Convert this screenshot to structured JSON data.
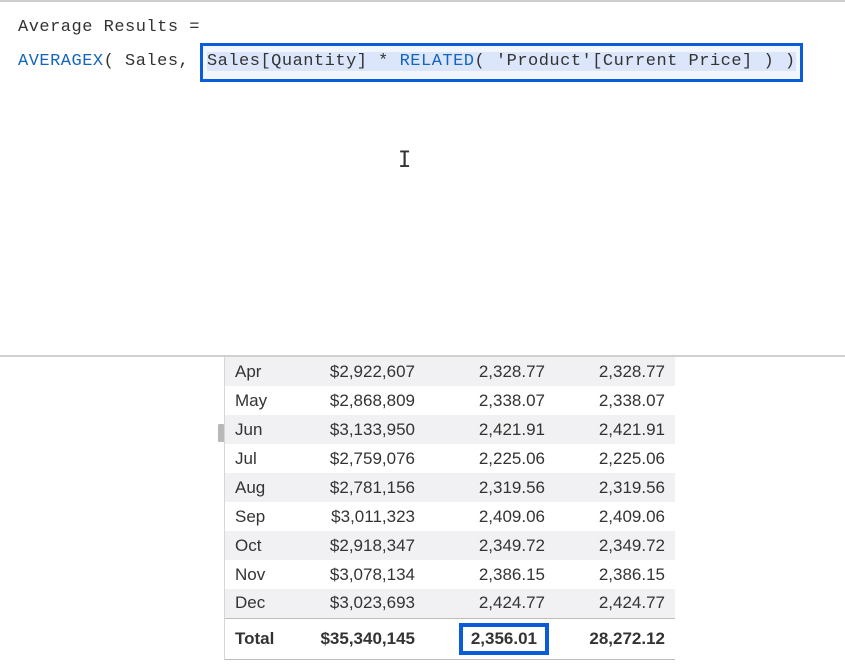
{
  "formula": {
    "line1_left": "Average Results",
    "line1_eq": " =",
    "fn_averagex": "AVERAGEX",
    "after_fn": "( Sales, ",
    "highlight_pre": "Sales[Quantity] * ",
    "fn_related": "RELATED",
    "highlight_post": "( 'Product'[Current Price] ) )"
  },
  "cursor_glyph": "I",
  "table": {
    "rows": [
      {
        "month": "Apr",
        "amount": "$2,922,607",
        "avg1": "2,328.77",
        "avg2": "2,328.77",
        "alt": true
      },
      {
        "month": "May",
        "amount": "$2,868,809",
        "avg1": "2,338.07",
        "avg2": "2,338.07",
        "alt": false
      },
      {
        "month": "Jun",
        "amount": "$3,133,950",
        "avg1": "2,421.91",
        "avg2": "2,421.91",
        "alt": true
      },
      {
        "month": "Jul",
        "amount": "$2,759,076",
        "avg1": "2,225.06",
        "avg2": "2,225.06",
        "alt": false
      },
      {
        "month": "Aug",
        "amount": "$2,781,156",
        "avg1": "2,319.56",
        "avg2": "2,319.56",
        "alt": true
      },
      {
        "month": "Sep",
        "amount": "$3,011,323",
        "avg1": "2,409.06",
        "avg2": "2,409.06",
        "alt": false
      },
      {
        "month": "Oct",
        "amount": "$2,918,347",
        "avg1": "2,349.72",
        "avg2": "2,349.72",
        "alt": true
      },
      {
        "month": "Nov",
        "amount": "$3,078,134",
        "avg1": "2,386.15",
        "avg2": "2,386.15",
        "alt": false
      },
      {
        "month": "Dec",
        "amount": "$3,023,693",
        "avg1": "2,424.77",
        "avg2": "2,424.77",
        "alt": true
      }
    ],
    "total": {
      "label": "Total",
      "amount": "$35,340,145",
      "avg1": "2,356.01",
      "avg2": "28,272.12"
    }
  }
}
